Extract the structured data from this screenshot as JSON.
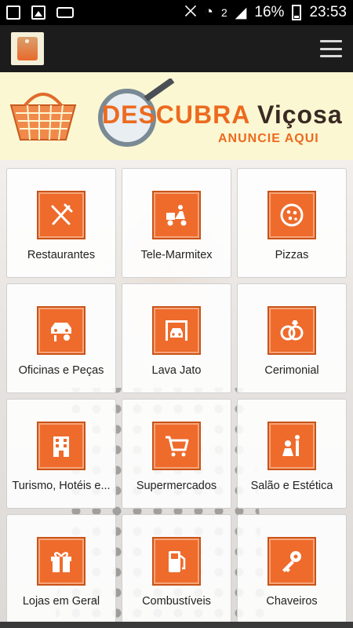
{
  "status_bar": {
    "battery_percent": "16%",
    "time": "23:53",
    "sim_slot": "2"
  },
  "banner": {
    "brand_part1": "DES",
    "brand_part2": "CUBRA",
    "brand_city": "Viçosa",
    "cta": "ANUNCIE AQUI"
  },
  "categories": [
    {
      "label": "Restaurantes",
      "icon": "utensils-icon"
    },
    {
      "label": "Tele-Marmitex",
      "icon": "delivery-scooter-icon"
    },
    {
      "label": "Pizzas",
      "icon": "pizza-icon"
    },
    {
      "label": "Oficinas e Peças",
      "icon": "car-repair-icon"
    },
    {
      "label": "Lava Jato",
      "icon": "car-wash-icon"
    },
    {
      "label": "Cerimonial",
      "icon": "rings-icon"
    },
    {
      "label": "Turismo, Hotéis e...",
      "icon": "hotel-icon"
    },
    {
      "label": "Supermercados",
      "icon": "shopping-cart-icon"
    },
    {
      "label": "Salão e Estética",
      "icon": "salon-icon"
    },
    {
      "label": "Lojas em Geral",
      "icon": "gift-icon"
    },
    {
      "label": "Combustíveis",
      "icon": "fuel-pump-icon"
    },
    {
      "label": "Chaveiros",
      "icon": "key-icon"
    }
  ],
  "colors": {
    "accent": "#ee6b2c",
    "banner_bg": "#fbf7d2",
    "app_bar": "#1c1c1c"
  }
}
